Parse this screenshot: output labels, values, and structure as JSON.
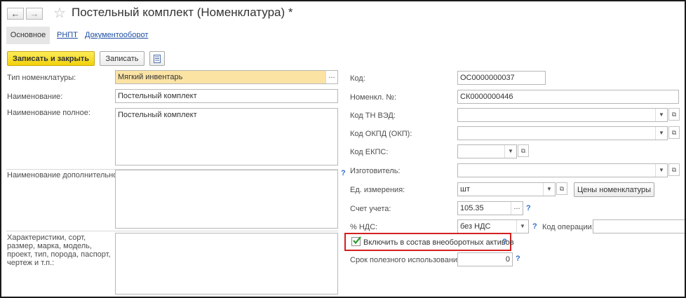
{
  "window": {
    "title": "Постельный комплект (Номенклатура) *"
  },
  "icons": {
    "back": "arrow-left-icon",
    "forward": "arrow-right-icon",
    "favorite": "star-icon",
    "report": "report-icon"
  },
  "tabs": [
    {
      "label": "Основное",
      "active": true
    },
    {
      "label": "РНПТ"
    },
    {
      "label": "Документооборот"
    }
  ],
  "toolbar": {
    "save_close_label": "Записать и закрыть",
    "save_label": "Записать"
  },
  "left": {
    "type": {
      "label": "Тип номенклатуры:",
      "value": "Мягкий инвентарь"
    },
    "name": {
      "label": "Наименование:",
      "value": "Постельный комплект"
    },
    "full_name": {
      "label": "Наименование полное:",
      "value": "Постельный комплект"
    },
    "additional": {
      "label": "Наименование дополнительное:",
      "value": ""
    },
    "characteristics": {
      "label": "Характеристики, сорт, размер, марка, модель, проект, тип, порода, паспорт, чертеж и т.п.:",
      "value": ""
    }
  },
  "right": {
    "code": {
      "label": "Код:",
      "value": "ОС0000000037"
    },
    "item_no": {
      "label": "Номенкл. №:",
      "value": "СК0000000446"
    },
    "tn_ved": {
      "label": "Код ТН ВЭД:",
      "value": ""
    },
    "okpd": {
      "label": "Код ОКПД (ОКП):",
      "value": ""
    },
    "ekps": {
      "label": "Код ЕКПС:",
      "value": ""
    },
    "manufacturer": {
      "label": "Изготовитель:",
      "value": ""
    },
    "unit": {
      "label": "Ед. измерения:",
      "value": "шт",
      "prices_button": "Цены номенклатуры"
    },
    "account": {
      "label": "Счет учета:",
      "value": "105.35"
    },
    "vat": {
      "label": "% НДС:",
      "value": "без НДС",
      "op_code_label": "Код операции:",
      "op_code_value": ""
    },
    "non_current": {
      "label": "Включить в состав внеоборотных активов",
      "checked": true
    },
    "useful_life": {
      "label": "Срок полезного использования:",
      "value": "0"
    }
  },
  "help_mark": "?"
}
